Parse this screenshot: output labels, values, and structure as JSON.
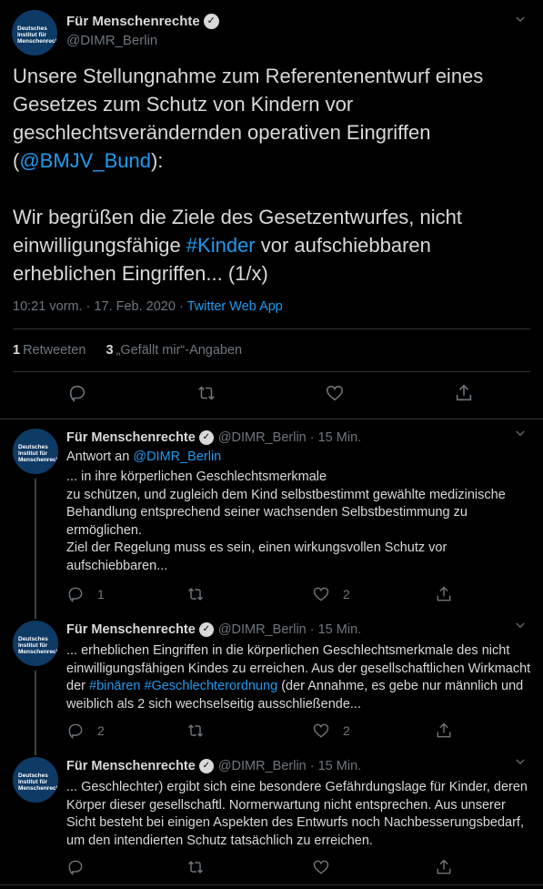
{
  "main_tweet": {
    "author_name": "Für Menschenrechte",
    "handle": "@DIMR_Berlin",
    "avatar_text": "Deutsches Institut für Menschenrechte",
    "text_part1": "Unsere Stellungnahme zum Referentenentwurf eines Gesetzes zum Schutz von Kindern vor geschlechtsverändernden operativen Eingriffen (",
    "mention": "@BMJV_Bund",
    "text_part2": "):",
    "text_part3": "Wir begrüßen die Ziele des Gesetzentwurfes, nicht einwilligungsfähige ",
    "hashtag": "#Kinder",
    "text_part4": " vor aufschiebbaren erheblichen Eingriffen... (1/x)",
    "timestamp": "10:21 vorm. · 17. Feb. 2020 · ",
    "source": "Twitter Web App",
    "retweet_count": "1",
    "retweet_label": "Retweeten",
    "like_count": "3",
    "like_label": "„Gefällt mir“-Angaben"
  },
  "replies": [
    {
      "author_name": "Für Menschenrechte",
      "handle": "@DIMR_Berlin",
      "time": "· 15 Min.",
      "reply_to_label": "Antwort an ",
      "reply_to": "@DIMR_Berlin",
      "line1": "... in ihre körperlichen Geschlechtsmerkmale",
      "line2": "zu schützen, und zugleich dem Kind selbstbestimmt gewählte medizinische Behandlung entsprechend seiner wachsenden Selbstbestimmung zu ermöglichen.",
      "line3": "Ziel der Regelung muss es sein, einen wirkungsvollen Schutz vor aufschiebbaren...",
      "reply_count": "1",
      "retweet_count": "",
      "like_count": "2"
    },
    {
      "author_name": "Für Menschenrechte",
      "handle": "@DIMR_Berlin",
      "time": "· 15 Min.",
      "text_a": "... erheblichen Eingriffen in die körperlichen Geschlechtsmerkmale des nicht einwilligungsfähigen Kindes zu erreichen. Aus der gesellschaftlichen Wirkmacht der ",
      "hashtag1": "#binären",
      "hashtag2": "#Geschlechterordnung",
      "text_b": " (der Annahme, es gebe nur männlich und weiblich als 2 sich wechselseitig ausschließende...",
      "reply_count": "2",
      "retweet_count": "",
      "like_count": "2"
    },
    {
      "author_name": "Für Menschenrechte",
      "handle": "@DIMR_Berlin",
      "time": "· 15 Min.",
      "text": "... Geschlechter) ergibt sich eine besondere Gefährdungslage für Kinder, deren Körper dieser gesellschaftl. Normerwartung nicht entsprechen. Aus unserer Sicht besteht bei einigen Aspekten des Entwurfs noch Nachbesserungsbedarf, um den intendierten Schutz tatsächlich zu erreichen.",
      "reply_count": "",
      "retweet_count": "",
      "like_count": ""
    }
  ],
  "icons": {
    "verified": "verified-badge-icon",
    "reply": "reply-icon",
    "retweet": "retweet-icon",
    "like": "heart-icon",
    "share": "share-icon",
    "more": "chevron-down-icon"
  },
  "colors": {
    "background": "#000000",
    "link": "#1d9bf0",
    "muted": "#6e767d",
    "text": "#d9d9d9"
  }
}
